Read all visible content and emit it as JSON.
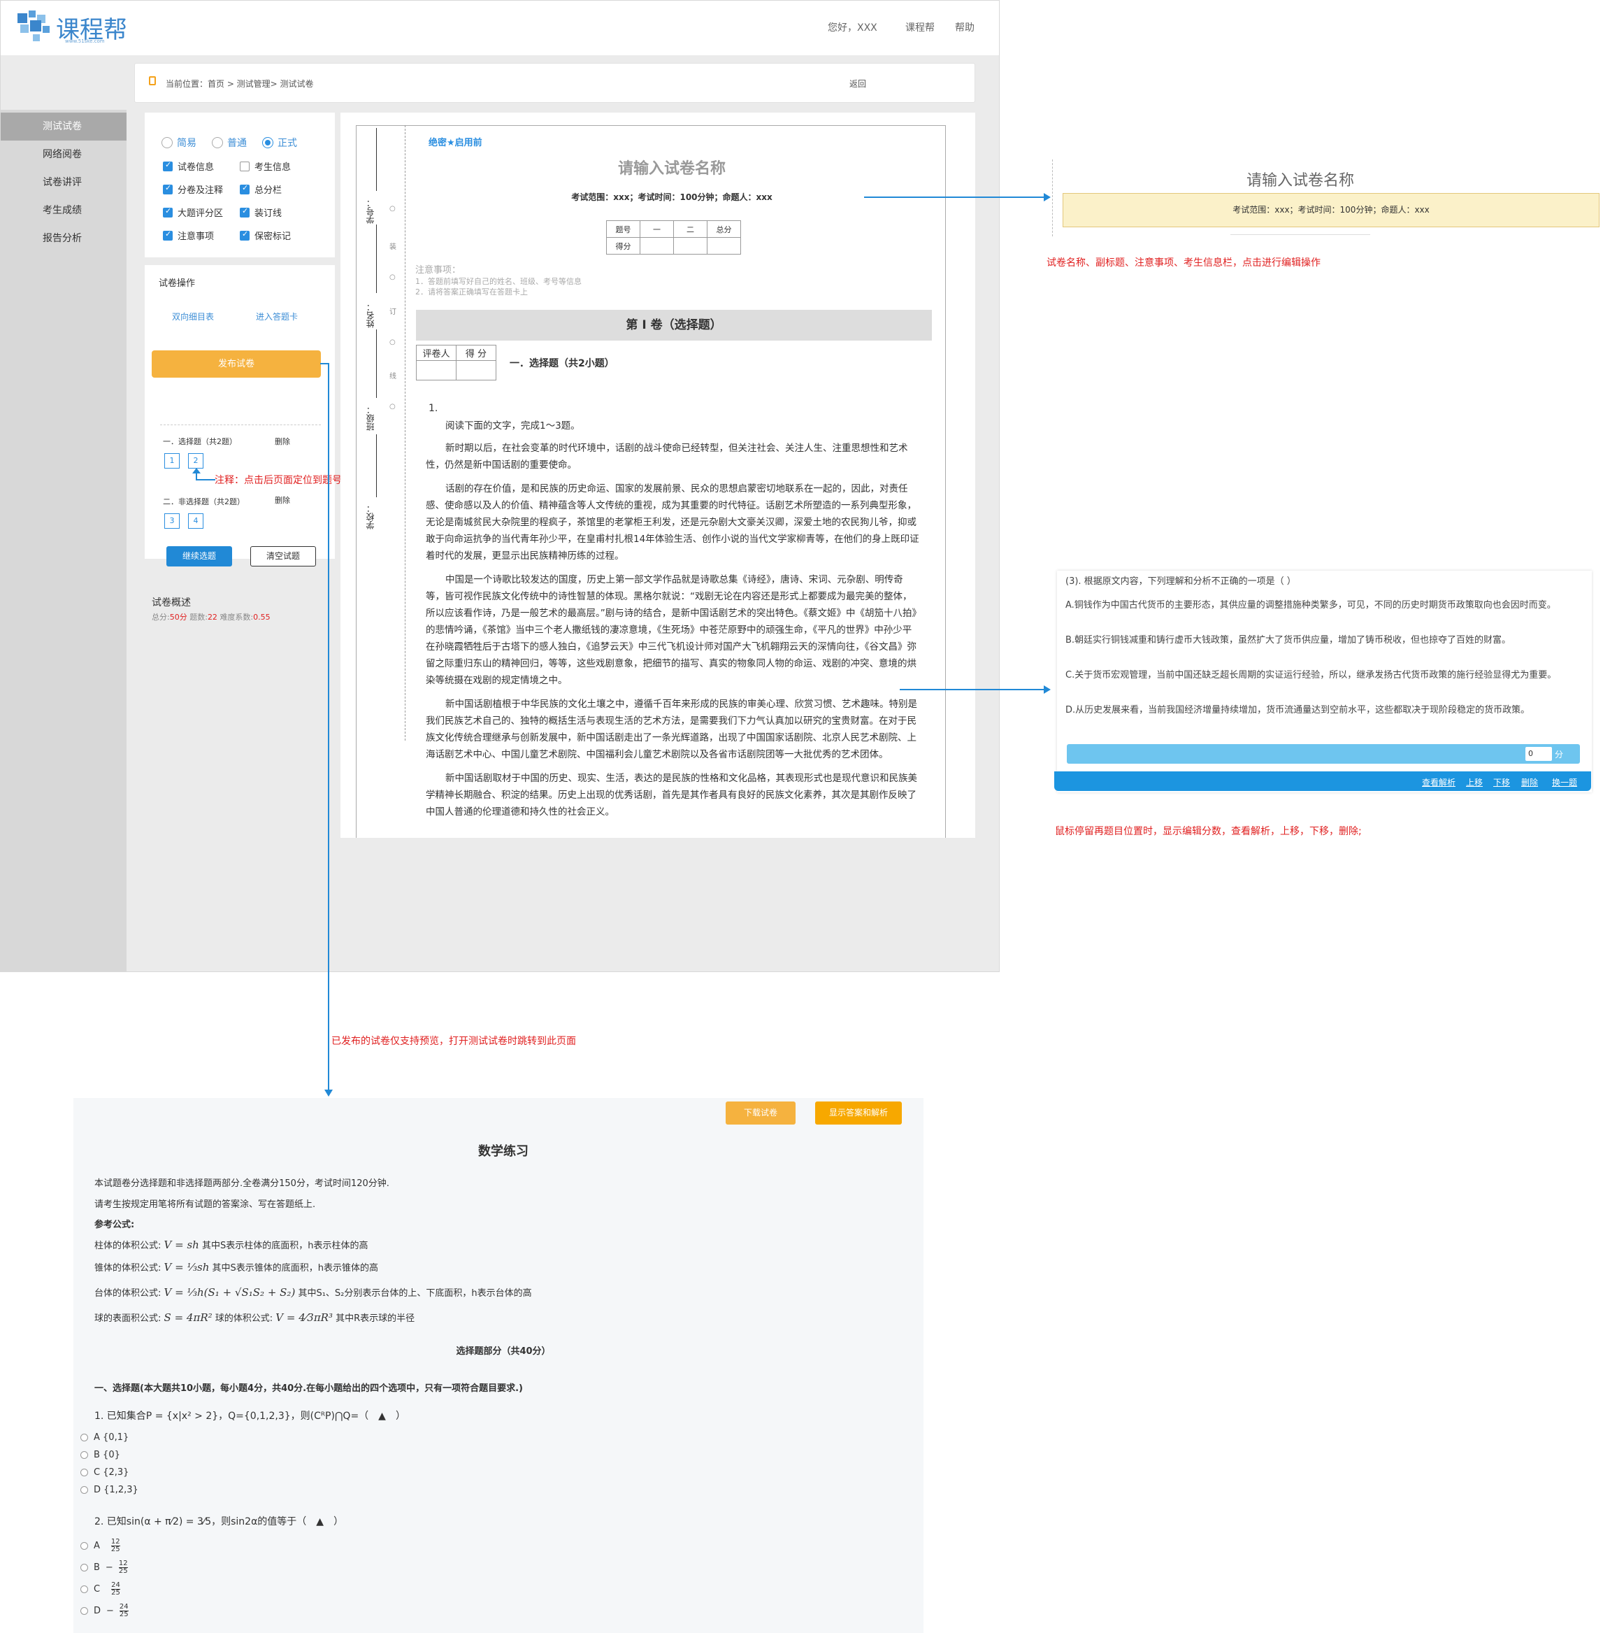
{
  "header": {
    "logo_text": "课程帮",
    "logo_url": "www.51ske.com",
    "greeting": "您好，XXX",
    "nav_course": "课程帮",
    "nav_help": "帮助"
  },
  "breadcrumb": {
    "text": "当前位置：首页 > 测试管理> 测试试卷",
    "back": "返回"
  },
  "sidebar": {
    "items": [
      {
        "label": "测试试卷"
      },
      {
        "label": "网络阅卷"
      },
      {
        "label": "试卷讲评"
      },
      {
        "label": "考生成绩"
      },
      {
        "label": "报告分析"
      }
    ]
  },
  "settings": {
    "difficulty": [
      "简易",
      "普通",
      "正式"
    ],
    "selected_difficulty": "正式",
    "options": [
      {
        "label": "试卷信息",
        "checked": true
      },
      {
        "label": "考生信息",
        "checked": false
      },
      {
        "label": "分卷及注释",
        "checked": true
      },
      {
        "label": "总分栏",
        "checked": true
      },
      {
        "label": "大题评分区",
        "checked": true
      },
      {
        "label": "装订线",
        "checked": true
      },
      {
        "label": "注意事项",
        "checked": true
      },
      {
        "label": "保密标记",
        "checked": true
      }
    ]
  },
  "operations": {
    "title": "试卷操作",
    "link_table": "双向细目表",
    "link_card": "进入答题卡",
    "publish": "发布试卷",
    "section1": "一．选择题（共2题）",
    "section2": "二．非选择题（共2题）",
    "delete": "删除",
    "numbers1": [
      "1",
      "2"
    ],
    "numbers2": [
      "3",
      "4"
    ],
    "annotation": "注释：点击后页面定位到题号位置",
    "continue": "继续选题",
    "clear": "清空试题"
  },
  "overview": {
    "title": "试卷概述",
    "total_label": "总分:",
    "total": "50分",
    "count_label": "题数:",
    "count": "22",
    "difficulty_label": "难度系数:",
    "difficulty": "0.55"
  },
  "paper": {
    "secret": "绝密★启用前",
    "title": "请输入试卷名称",
    "subtitle": "考试范围：xxx；考试时间：100分钟；命题人：xxx",
    "score_header": [
      "题号",
      "一",
      "二",
      "总分"
    ],
    "score_row": "得分",
    "notes_title": "注意事项：",
    "notes": [
      "1．答题前填写好自己的姓名、班级、考号等信息",
      "2．请将答案正确填写在答题卡上"
    ],
    "part_title": "第 I 卷（选择题）",
    "grader": [
      "评卷人",
      "得 分"
    ],
    "section": "一．选择题（共2小题）",
    "q_number": "1.",
    "binding": {
      "labels": [
        "学号：",
        "姓名：",
        "班级：",
        "学校："
      ],
      "marks": [
        "○",
        "装",
        "○",
        "订",
        "○",
        "线",
        "○"
      ]
    },
    "passage": [
      "阅读下面的文字，完成1～3题。",
      "新时期以后，在社会变革的时代环境中，话剧的战斗使命已经转型，但关注社会、关注人生、注重思想性和艺术性，仍然是新中国话剧的重要使命。",
      "话剧的存在价值，是和民族的历史命运、国家的发展前景、民众的思想启蒙密切地联系在一起的，因此，对责任感、使命感以及人的价值、精神蕴含等人文传统的重视，成为其重要的时代特征。话剧艺术所塑造的一系列典型形象，无论是南城贫民大杂院里的程疯子，茶馆里的老掌柜王利发，还是元杂剧大文豪关汉卿，深爱土地的农民狗儿爷，抑或敢于向命运抗争的当代青年孙少平，在皇甫村扎根14年体验生活、创作小说的当代文学家柳青等，在他们的身上既印证着时代的发展，更显示出民族精神历练的过程。",
      "中国是一个诗歌比较发达的国度，历史上第一部文学作品就是诗歌总集《诗经》，唐诗、宋词、元杂剧、明传奇等，皆可视作民族文化传统中的诗性智慧的体现。黑格尔就说：“戏剧无论在内容还是形式上都要成为最完美的整体，所以应该看作诗，乃是一般艺术的最高层。”剧与诗的结合，是新中国话剧艺术的突出特色。《蔡文姬》中《胡笳十八拍》的悲情吟诵，《茶馆》当中三个老人撒纸钱的凄凉意境，《生死场》中苍茫原野中的顽强生命，《平凡的世界》中孙少平在孙晓霞牺牲后于古塔下的感人独白，《追梦云天》中三代飞机设计师对国产大飞机翱翔云天的深情向往，《谷文昌》弥留之际重归东山的精神回归，等等，这些戏剧意象，把细节的描写、真实的物象同人物的命运、戏剧的冲突、意境的烘染等统摄在戏剧的规定情境之中。",
      "新中国话剧植根于中华民族的文化土壤之中，遵循千百年来形成的民族的审美心理、欣赏习惯、艺术趣味。特别是我们民族艺术自己的、独特的概括生活与表现生活的艺术方法，是需要我们下力气认真加以研究的宝贵财富。在对于民族文化传统合理继承与创新发展中，新中国话剧走出了一条光辉道路，出现了中国国家话剧院、北京人民艺术剧院、上海话剧艺术中心、中国儿童艺术剧院、中国福利会儿童艺术剧院以及各省市话剧院团等一大批优秀的艺术团体。",
      "新中国话剧取材于中国的历史、现实、生活，表达的是民族的性格和文化品格，其表现形式也是现代意识和民族美学精神长期融合、积淀的结果。历史上出现的优秀话剧，首先是其作者具有良好的民族文化素养，其次是其剧作反映了中国人普通的伦理道德和持久性的社会正义。"
    ]
  },
  "edit_preview": {
    "title": "请输入试卷名称",
    "subtitle": "考试范围：xxx；考试时间：100分钟；命题人：xxx",
    "note": "试卷名称、副标题、注意事项、考生信息栏，点击进行编辑操作"
  },
  "hover_card": {
    "question": "(3). 根据原文内容，下列理解和分析不正确的一项是（  ）",
    "options": [
      "A.铜钱作为中国古代货币的主要形态，其供应量的调整措施种类繁多，可见，不同的历史时期货币政策取向也会因时而变。",
      "B.朝廷实行铜钱减重和铸行虚币大钱政策，虽然扩大了货币供应量，增加了铸币税收，但也掠夺了百姓的财富。",
      "C.关于货币宏观管理，当前中国还缺乏超长周期的实证运行经验，所以，继承发扬古代货币政策的施行经验显得尤为重要。",
      "D.从历史发展来看，当前我国经济增量持续增加，货币流通量达到空前水平，这些都取决于现阶段稳定的货币政策。"
    ],
    "score_value": "0",
    "score_unit": "分",
    "actions": [
      "查看解析",
      "上移",
      "下移",
      "删除",
      "换一题"
    ],
    "note": "鼠标停留再题目位置时，显示编辑分数，查看解析，上移，下移，删除;"
  },
  "publish_note": "已发布的试卷仅支持预览，打开测试试卷时跳转到此页面",
  "preview": {
    "download": "下载试卷",
    "show_answers": "显示答案和解析",
    "title": "数学练习",
    "intro1": "本试题卷分选择题和非选择题两部分.全卷满分150分，考试时间120分钟.",
    "intro2": "请考生按规定用笔将所有试题的答案涂、写在答题纸上.",
    "formula_title": "参考公式:",
    "f1_label": "柱体的体积公式:",
    "f1_expr": "V = sh",
    "f1_desc": "其中S表示柱体的底面积，h表示柱体的高",
    "f2_label": "锥体的体积公式:",
    "f2_expr": "V = ⅓sh",
    "f2_desc": "其中S表示锥体的底面积，h表示锥体的高",
    "f3_label": "台体的体积公式:",
    "f3_expr": "V = ⅓h(S₁ + √S₁S₂ + S₂)",
    "f3_desc": "其中S₁、S₂分别表示台体的上、下底面积，h表示台体的高",
    "f4_label": "球的表面积公式:",
    "f4_expr": "S = 4πR²",
    "f4_mid": "球的体积公式:",
    "f4_expr2": "V = 4⁄3πR³",
    "f4_desc": "其中R表示球的半径",
    "section_part": "选择题部分（共40分）",
    "section_title": "一、选择题(本大题共10小题，每小题4分，共40分.在每小题给出的四个选项中，只有一项符合题目要求.)",
    "q1": "1. 已知集合P = {x|x² > 2}，Q={0,1,2,3}，则(CᴿP)⋂Q=（　▲　）",
    "q1_options": [
      "A {0,1}",
      "B {0}",
      "C {2,3}",
      "D {1,2,3}"
    ],
    "q2": "2. 已知sin(α + π⁄2) = 3⁄5，则sin2α的值等于（　▲　）",
    "q2_options": [
      {
        "letter": "A",
        "sign": "",
        "num": "12",
        "den": "25"
      },
      {
        "letter": "B",
        "sign": "−",
        "num": "12",
        "den": "25"
      },
      {
        "letter": "C",
        "sign": "",
        "num": "24",
        "den": "25"
      },
      {
        "letter": "D",
        "sign": "−",
        "num": "24",
        "den": "25"
      }
    ]
  }
}
